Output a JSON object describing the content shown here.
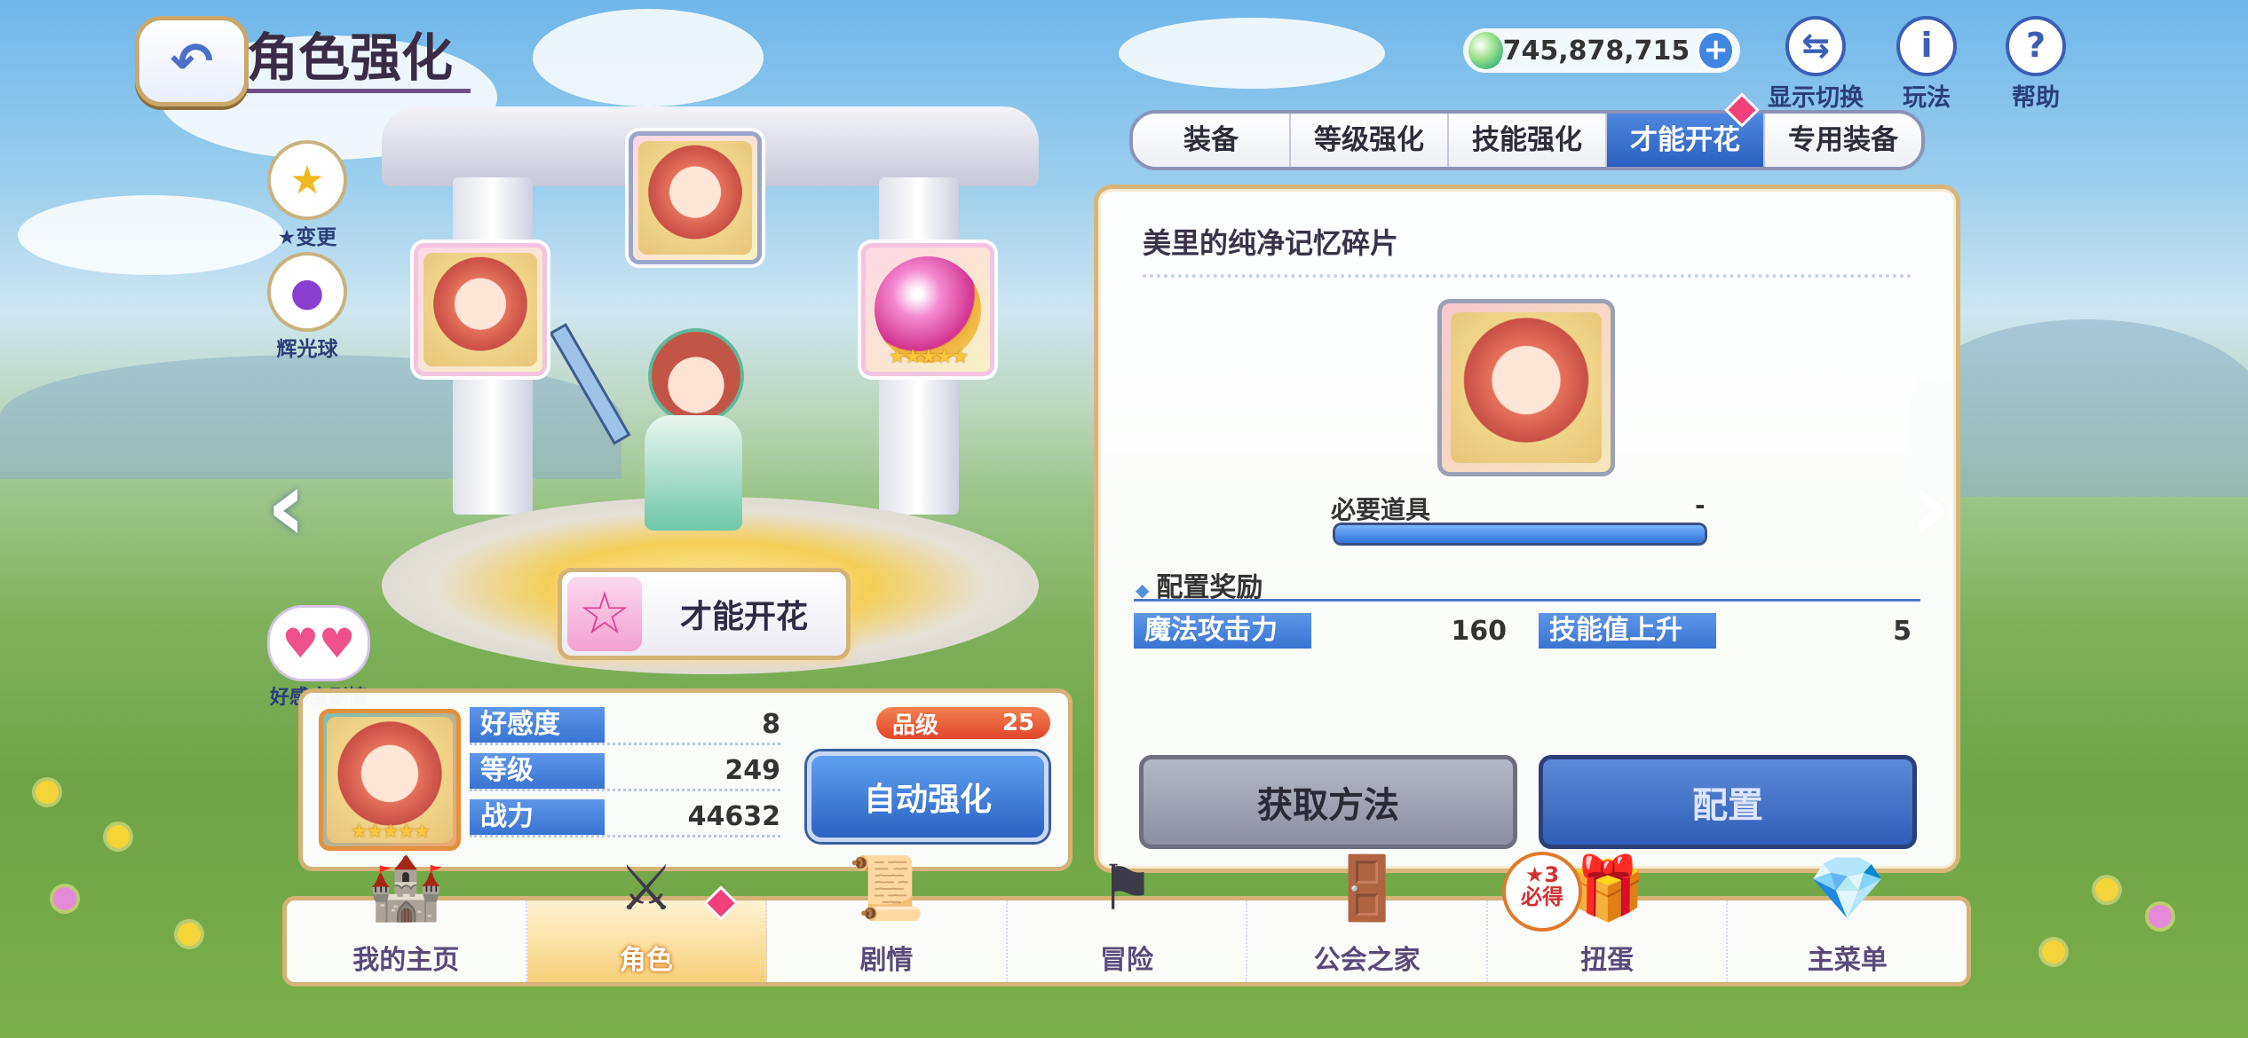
{
  "header": {
    "title": "角色强化",
    "back_icon": "back-arrow-icon"
  },
  "currency": {
    "value": "745,878,715",
    "icon": "jewel-icon"
  },
  "top_icons": [
    {
      "label": "显示切换",
      "icon": "switch-display-icon"
    },
    {
      "label": "玩法",
      "icon": "info-icon"
    },
    {
      "label": "帮助",
      "icon": "help-icon"
    }
  ],
  "tabs": [
    {
      "label": "装备"
    },
    {
      "label": "等级强化"
    },
    {
      "label": "技能强化"
    },
    {
      "label": "才能开花",
      "active": true
    },
    {
      "label": "专用装备"
    }
  ],
  "side_buttons": {
    "star_change": "★变更",
    "glow_orb": "辉光球",
    "affection_story": "好感度剧情"
  },
  "bloom_button": {
    "label": "才能开花"
  },
  "panel": {
    "item_name": "美里的纯净记忆碎片",
    "required_label": "必要道具",
    "required_value": "-",
    "required_progress": 1.0,
    "reward_header": "配置奖励",
    "rewards": [
      {
        "label": "魔法攻击力",
        "value": "160"
      },
      {
        "label": "技能值上升",
        "value": "5"
      }
    ],
    "get_button": "获取方法",
    "set_button": "配置"
  },
  "status": {
    "rows": [
      {
        "label": "好感度",
        "value": "8"
      },
      {
        "label": "等级",
        "value": "249"
      },
      {
        "label": "战力",
        "value": "44632"
      }
    ],
    "grade_label": "品级",
    "grade_value": "25",
    "auto_button": "自动强化",
    "portrait_stars": "★★★★★"
  },
  "slot_stars": "★★★★★",
  "bottom_nav": [
    {
      "label": "我的主页",
      "icon": "home-castle-icon"
    },
    {
      "label": "角色",
      "icon": "character-icon",
      "active": true
    },
    {
      "label": "剧情",
      "icon": "story-scroll-icon"
    },
    {
      "label": "冒险",
      "icon": "adventure-flag-icon"
    },
    {
      "label": "公会之家",
      "icon": "guild-house-icon"
    },
    {
      "label": "扭蛋",
      "icon": "gacha-icon"
    },
    {
      "label": "主菜单",
      "icon": "main-menu-crystal-icon"
    }
  ],
  "gacha_badge": {
    "count": "★3",
    "text": "必得"
  },
  "colors": {
    "accent_blue": "#3a74d3",
    "gold_border": "#d3b377",
    "grade_red": "#e0452a"
  }
}
